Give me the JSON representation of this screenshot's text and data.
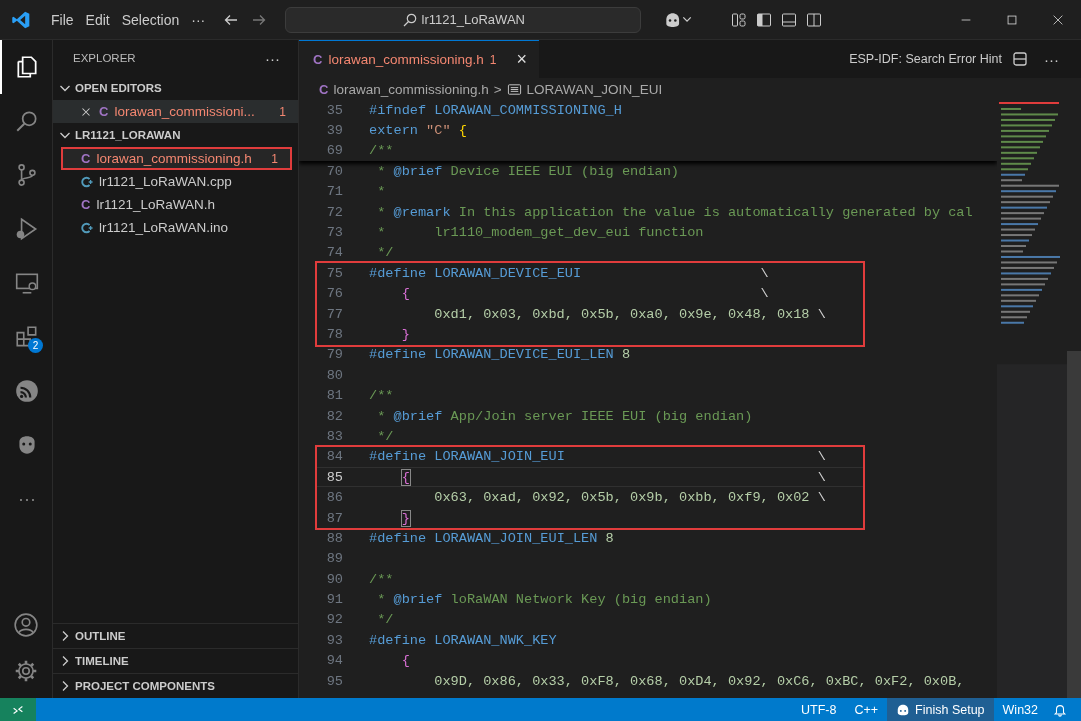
{
  "title_bar": {
    "menu": [
      "File",
      "Edit",
      "Selection"
    ],
    "more": "···",
    "search": {
      "value": "lr1121_LoRaWAN"
    }
  },
  "activity_bar": {
    "items": [
      {
        "kind": "explorer",
        "selected": true
      },
      {
        "kind": "search",
        "selected": false
      },
      {
        "kind": "source-control",
        "selected": false
      },
      {
        "kind": "run-debug",
        "selected": false
      },
      {
        "kind": "remote",
        "selected": false
      },
      {
        "kind": "extensions",
        "selected": false,
        "badge": "2"
      },
      {
        "kind": "esp-idf",
        "selected": false
      },
      {
        "kind": "bug",
        "selected": false
      },
      {
        "kind": "more",
        "selected": false,
        "label": "···"
      }
    ],
    "bottom": [
      {
        "kind": "account"
      },
      {
        "kind": "settings"
      }
    ]
  },
  "sidebar": {
    "title": "EXPLORER",
    "more": "···",
    "open_editors": {
      "title": "OPEN EDITORS",
      "expanded": true,
      "items": [
        {
          "name": "lorawan_commissioni...",
          "kind": "c",
          "icon": "C",
          "badge": "1",
          "error": true
        }
      ]
    },
    "folder": {
      "title": "LR1121_LORAWAN",
      "expanded": true,
      "items": [
        {
          "name": "lorawan_commissioning.h",
          "kind": "c",
          "icon": "C",
          "badge": "1",
          "error": true,
          "outlined": true
        },
        {
          "name": "lr1121_LoRaWAN.cpp",
          "kind": "cpp",
          "error": false,
          "outlined": false
        },
        {
          "name": "lr1121_LoRaWAN.h",
          "kind": "c",
          "icon": "C",
          "error": false,
          "outlined": false
        },
        {
          "name": "lr1121_LoRaWAN.ino",
          "kind": "cpp",
          "error": false,
          "outlined": false
        }
      ]
    },
    "sections": [
      {
        "title": "OUTLINE",
        "expanded": false
      },
      {
        "title": "TIMELINE",
        "expanded": false
      },
      {
        "title": "PROJECT COMPONENTS",
        "expanded": false
      }
    ]
  },
  "editor": {
    "tab": {
      "icon": "C",
      "name": "lorawan_commissioning.h",
      "badge": "1",
      "close": "×",
      "error": true,
      "selected": true
    },
    "actions": {
      "hint": "ESP-IDF: Search Error Hint",
      "more": "···"
    },
    "breadcrumb": [
      {
        "kind": "file",
        "icon": "C",
        "label": "lorawan_commissioning.h"
      },
      {
        "kind": "separator",
        "label": ">"
      },
      {
        "kind": "symbol",
        "label": "LORAWAN_JOIN_EUI"
      }
    ],
    "sticky_lines": [
      {
        "number": "35",
        "tokens": [
          {
            "kind": "keyword",
            "text": "#ifndef"
          },
          {
            "kind": "macro",
            "text": " LORAWAN_COMMISSIONING_H"
          }
        ]
      },
      {
        "number": "39",
        "tokens": [
          {
            "kind": "keyword",
            "text": "extern"
          },
          {
            "kind": "string",
            "text": " \"C\""
          },
          {
            "kind": "bracket1",
            "text": " {"
          }
        ]
      },
      {
        "number": "69",
        "tokens": [
          {
            "kind": "comment",
            "text": "/**"
          }
        ]
      }
    ],
    "blocks": [
      {
        "boxed": false,
        "lines": [
          {
            "number": "70",
            "current": false,
            "tokens": [
              {
                "kind": "comment",
                "text": " * "
              },
              {
                "kind": "doctag",
                "text": "@brief"
              },
              {
                "kind": "comment",
                "text": " Device IEEE EUI (big endian)"
              }
            ]
          },
          {
            "number": "71",
            "current": false,
            "tokens": [
              {
                "kind": "comment",
                "text": " *"
              }
            ]
          },
          {
            "number": "72",
            "current": false,
            "tokens": [
              {
                "kind": "comment",
                "text": " * "
              },
              {
                "kind": "doctag",
                "text": "@remark"
              },
              {
                "kind": "comment",
                "text": " In this application the value is automatically generated by cal"
              }
            ]
          },
          {
            "number": "73",
            "current": false,
            "tokens": [
              {
                "kind": "comment",
                "text": " *      lr1110_modem_get_dev_eui function"
              }
            ]
          },
          {
            "number": "74",
            "current": false,
            "tokens": [
              {
                "kind": "comment",
                "text": " */"
              }
            ]
          }
        ]
      },
      {
        "boxed": true,
        "lines": [
          {
            "number": "75",
            "current": false,
            "tokens": [
              {
                "kind": "keyword",
                "text": "#define"
              },
              {
                "kind": "macro",
                "text": " LORAWAN_DEVICE_EUI"
              },
              {
                "kind": "plain",
                "text": "                      \\"
              }
            ]
          },
          {
            "number": "76",
            "current": false,
            "tokens": [
              {
                "kind": "bracket2",
                "text": "    {"
              },
              {
                "kind": "plain",
                "text": "                                           \\"
              }
            ]
          },
          {
            "number": "77",
            "current": false,
            "tokens": [
              {
                "kind": "number",
                "text": "        0xd1, 0x03, 0xbd, 0x5b, 0xa0, 0x9e, 0x48, 0x18"
              },
              {
                "kind": "plain",
                "text": " \\"
              }
            ]
          },
          {
            "number": "78",
            "current": false,
            "tokens": [
              {
                "kind": "bracket2",
                "text": "    }"
              }
            ]
          }
        ]
      },
      {
        "boxed": false,
        "lines": [
          {
            "number": "79",
            "current": false,
            "tokens": [
              {
                "kind": "keyword",
                "text": "#define"
              },
              {
                "kind": "macro",
                "text": " LORAWAN_DEVICE_EUI_LEN"
              },
              {
                "kind": "number",
                "text": " 8"
              }
            ]
          },
          {
            "number": "80",
            "current": false
          },
          {
            "number": "81",
            "current": false,
            "tokens": [
              {
                "kind": "comment",
                "text": "/**"
              }
            ]
          },
          {
            "number": "82",
            "current": false,
            "tokens": [
              {
                "kind": "comment",
                "text": " * "
              },
              {
                "kind": "doctag",
                "text": "@brief"
              },
              {
                "kind": "comment",
                "text": " App/Join server IEEE EUI (big endian)"
              }
            ]
          },
          {
            "number": "83",
            "current": false,
            "tokens": [
              {
                "kind": "comment",
                "text": " */"
              }
            ]
          }
        ]
      },
      {
        "boxed": true,
        "lines": [
          {
            "number": "84",
            "current": false,
            "tokens": [
              {
                "kind": "keyword",
                "text": "#define"
              },
              {
                "kind": "macro",
                "text": " LORAWAN_JOIN_EUI"
              },
              {
                "kind": "plain",
                "text": "                               \\"
              }
            ]
          },
          {
            "number": "85",
            "current": true,
            "tokens": [
              {
                "kind": "bracket-match",
                "text": "    {"
              },
              {
                "kind": "plain",
                "text": "                                                  \\"
              }
            ]
          },
          {
            "number": "86",
            "current": false,
            "tokens": [
              {
                "kind": "number",
                "text": "        0x63, 0xad, 0x92, 0x5b, 0x9b, 0xbb, 0xf9, 0x02"
              },
              {
                "kind": "plain",
                "text": " \\"
              }
            ]
          },
          {
            "number": "87",
            "current": false,
            "tokens": [
              {
                "kind": "bracket-match",
                "text": "    }"
              }
            ]
          }
        ]
      },
      {
        "boxed": false,
        "lines": [
          {
            "number": "88",
            "current": false,
            "tokens": [
              {
                "kind": "keyword",
                "text": "#define"
              },
              {
                "kind": "macro",
                "text": " LORAWAN_JOIN_EUI_LEN"
              },
              {
                "kind": "number",
                "text": " 8"
              }
            ]
          },
          {
            "number": "89",
            "current": false
          },
          {
            "number": "90",
            "current": false,
            "tokens": [
              {
                "kind": "comment",
                "text": "/**"
              }
            ]
          },
          {
            "number": "91",
            "current": false,
            "tokens": [
              {
                "kind": "comment",
                "text": " * "
              },
              {
                "kind": "doctag",
                "text": "@brief"
              },
              {
                "kind": "comment",
                "text": " loRaWAN Network Key (big endian)"
              }
            ]
          },
          {
            "number": "92",
            "current": false,
            "tokens": [
              {
                "kind": "comment",
                "text": " */"
              }
            ]
          },
          {
            "number": "93",
            "current": false,
            "tokens": [
              {
                "kind": "keyword",
                "text": "#define"
              },
              {
                "kind": "macro",
                "text": " LORAWAN_NWK_KEY"
              }
            ]
          },
          {
            "number": "94",
            "current": false,
            "tokens": [
              {
                "kind": "bracket2",
                "text": "    {"
              }
            ]
          },
          {
            "number": "95",
            "current": false,
            "tokens": [
              {
                "kind": "number",
                "text": "        0x9D, 0x86, 0x33, 0xF8, 0x68, 0xD4, 0x92, 0xC6, 0xBC, 0xF2, 0x0B,"
              }
            ]
          }
        ]
      }
    ]
  },
  "status_bar": {
    "items": [
      {
        "kind": "text",
        "label": "UTF-8"
      },
      {
        "kind": "text",
        "label": "C++"
      },
      {
        "kind": "setup",
        "label": "Finish Setup"
      },
      {
        "kind": "text",
        "label": "Win32"
      },
      {
        "kind": "bell"
      }
    ]
  }
}
